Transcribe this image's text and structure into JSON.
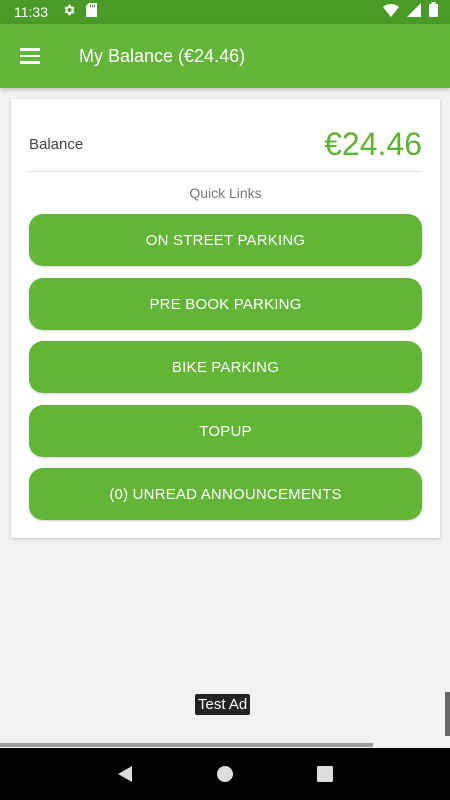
{
  "status_bar": {
    "time": "11:33",
    "icons": [
      "gear-icon",
      "sd-card-icon",
      "wifi-icon",
      "signal-icon",
      "battery-icon"
    ]
  },
  "app_bar": {
    "title": "My Balance (€24.46)"
  },
  "balance": {
    "label": "Balance",
    "value": "€24.46"
  },
  "quick_links": {
    "label": "Quick Links",
    "buttons": [
      "ON STREET PARKING",
      "PRE BOOK PARKING",
      "BIKE PARKING",
      "TOPUP",
      "(0) UNREAD ANNOUNCEMENTS"
    ]
  },
  "ad": {
    "label": "Test Ad"
  },
  "colors": {
    "primary": "#62b536",
    "status_bar": "#4a9a28",
    "balance_value": "#5fb233",
    "background": "#f2f2f2"
  }
}
